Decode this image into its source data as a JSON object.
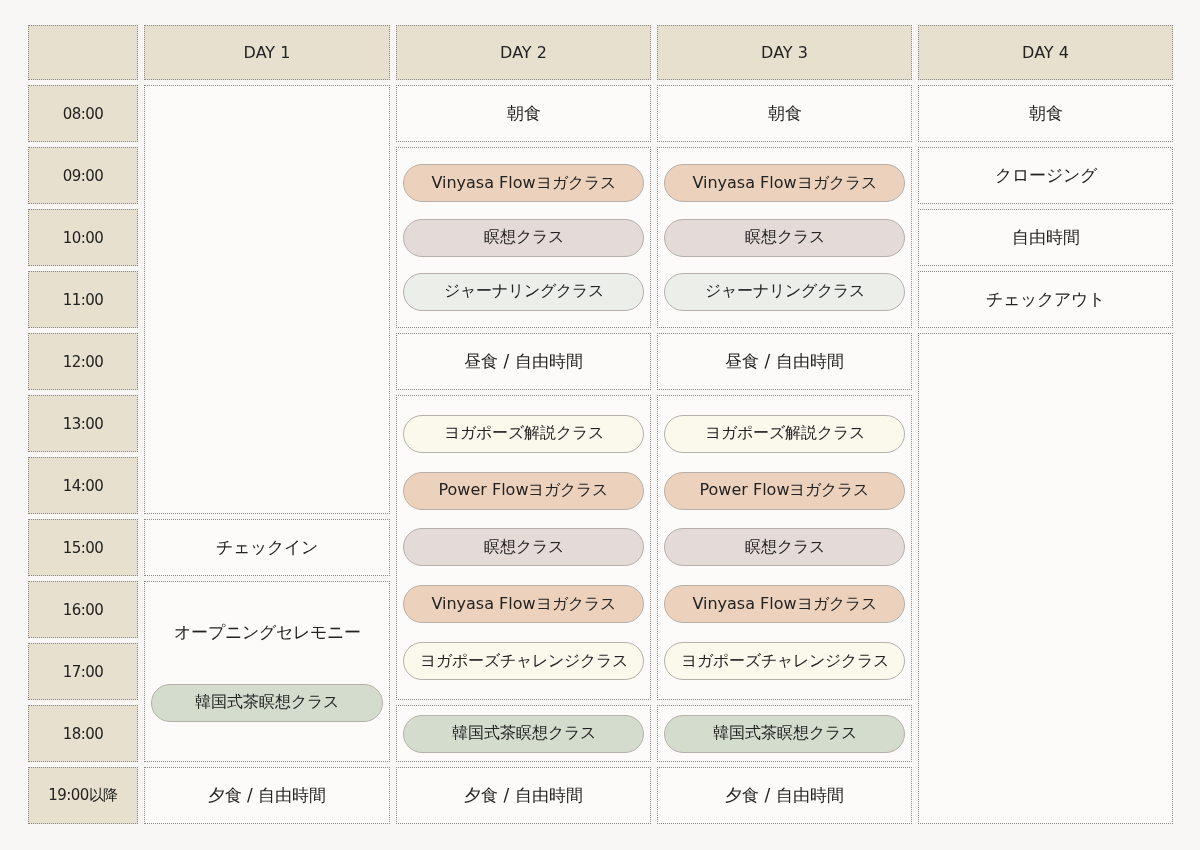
{
  "days": [
    {
      "title": "DAY 1",
      "blocks": [
        {
          "kind": "empty"
        },
        {
          "kind": "event",
          "label": "チェックイン"
        },
        {
          "kind": "event",
          "label": "オープニングセレモニー",
          "classes": [
            {
              "name": "韓国式茶瞑想クラス",
              "color": "#d3dccd"
            }
          ]
        },
        {
          "kind": "event",
          "label": "夕食 / 自由時間"
        }
      ]
    },
    {
      "title": "DAY 2",
      "blocks": [
        {
          "kind": "event",
          "label": "朝食"
        },
        {
          "kind": "event",
          "classes": [
            {
              "name": "Vinyasa Flowヨガクラス",
              "color": "#ecd1bc"
            },
            {
              "name": "瞑想クラス",
              "color": "#e4dad7"
            },
            {
              "name": "ジャーナリングクラス",
              "color": "#eceeea"
            }
          ]
        },
        {
          "kind": "event",
          "label": "昼食 / 自由時間"
        },
        {
          "kind": "event",
          "classes": [
            {
              "name": "ヨガポーズ解説クラス",
              "color": "#fbf8ec"
            },
            {
              "name": "Power Flowヨガクラス",
              "color": "#ecd1bc"
            },
            {
              "name": "瞑想クラス",
              "color": "#e4dad7"
            },
            {
              "name": "Vinyasa Flowヨガクラス",
              "color": "#ecd1bc"
            },
            {
              "name": "ヨガポーズチャレンジクラス",
              "color": "#fbf8ec"
            }
          ]
        },
        {
          "kind": "event",
          "classes": [
            {
              "name": "韓国式茶瞑想クラス",
              "color": "#d3dccd"
            }
          ]
        },
        {
          "kind": "event",
          "label": "夕食 / 自由時間"
        }
      ]
    },
    {
      "title": "DAY 3",
      "blocks": [
        {
          "kind": "event",
          "label": "朝食"
        },
        {
          "kind": "event",
          "classes": [
            {
              "name": "Vinyasa Flowヨガクラス",
              "color": "#ecd1bc"
            },
            {
              "name": "瞑想クラス",
              "color": "#e4dad7"
            },
            {
              "name": "ジャーナリングクラス",
              "color": "#eceeea"
            }
          ]
        },
        {
          "kind": "event",
          "label": "昼食 / 自由時間"
        },
        {
          "kind": "event",
          "classes": [
            {
              "name": "ヨガポーズ解説クラス",
              "color": "#fbf8ec"
            },
            {
              "name": "Power Flowヨガクラス",
              "color": "#ecd1bc"
            },
            {
              "name": "瞑想クラス",
              "color": "#e4dad7"
            },
            {
              "name": "Vinyasa Flowヨガクラス",
              "color": "#ecd1bc"
            },
            {
              "name": "ヨガポーズチャレンジクラス",
              "color": "#fbf8ec"
            }
          ]
        },
        {
          "kind": "event",
          "classes": [
            {
              "name": "韓国式茶瞑想クラス",
              "color": "#d3dccd"
            }
          ]
        },
        {
          "kind": "event",
          "label": "夕食 / 自由時間"
        }
      ]
    },
    {
      "title": "DAY 4",
      "blocks": [
        {
          "kind": "event",
          "label": "朝食"
        },
        {
          "kind": "event",
          "label": "クロージング"
        },
        {
          "kind": "event",
          "label": "自由時間"
        },
        {
          "kind": "event",
          "label": "チェックアウト"
        },
        {
          "kind": "empty"
        }
      ]
    }
  ],
  "times": [
    "08:00",
    "09:00",
    "10:00",
    "11:00",
    "12:00",
    "13:00",
    "14:00",
    "15:00",
    "16:00",
    "17:00",
    "18:00",
    "19:00以降"
  ]
}
